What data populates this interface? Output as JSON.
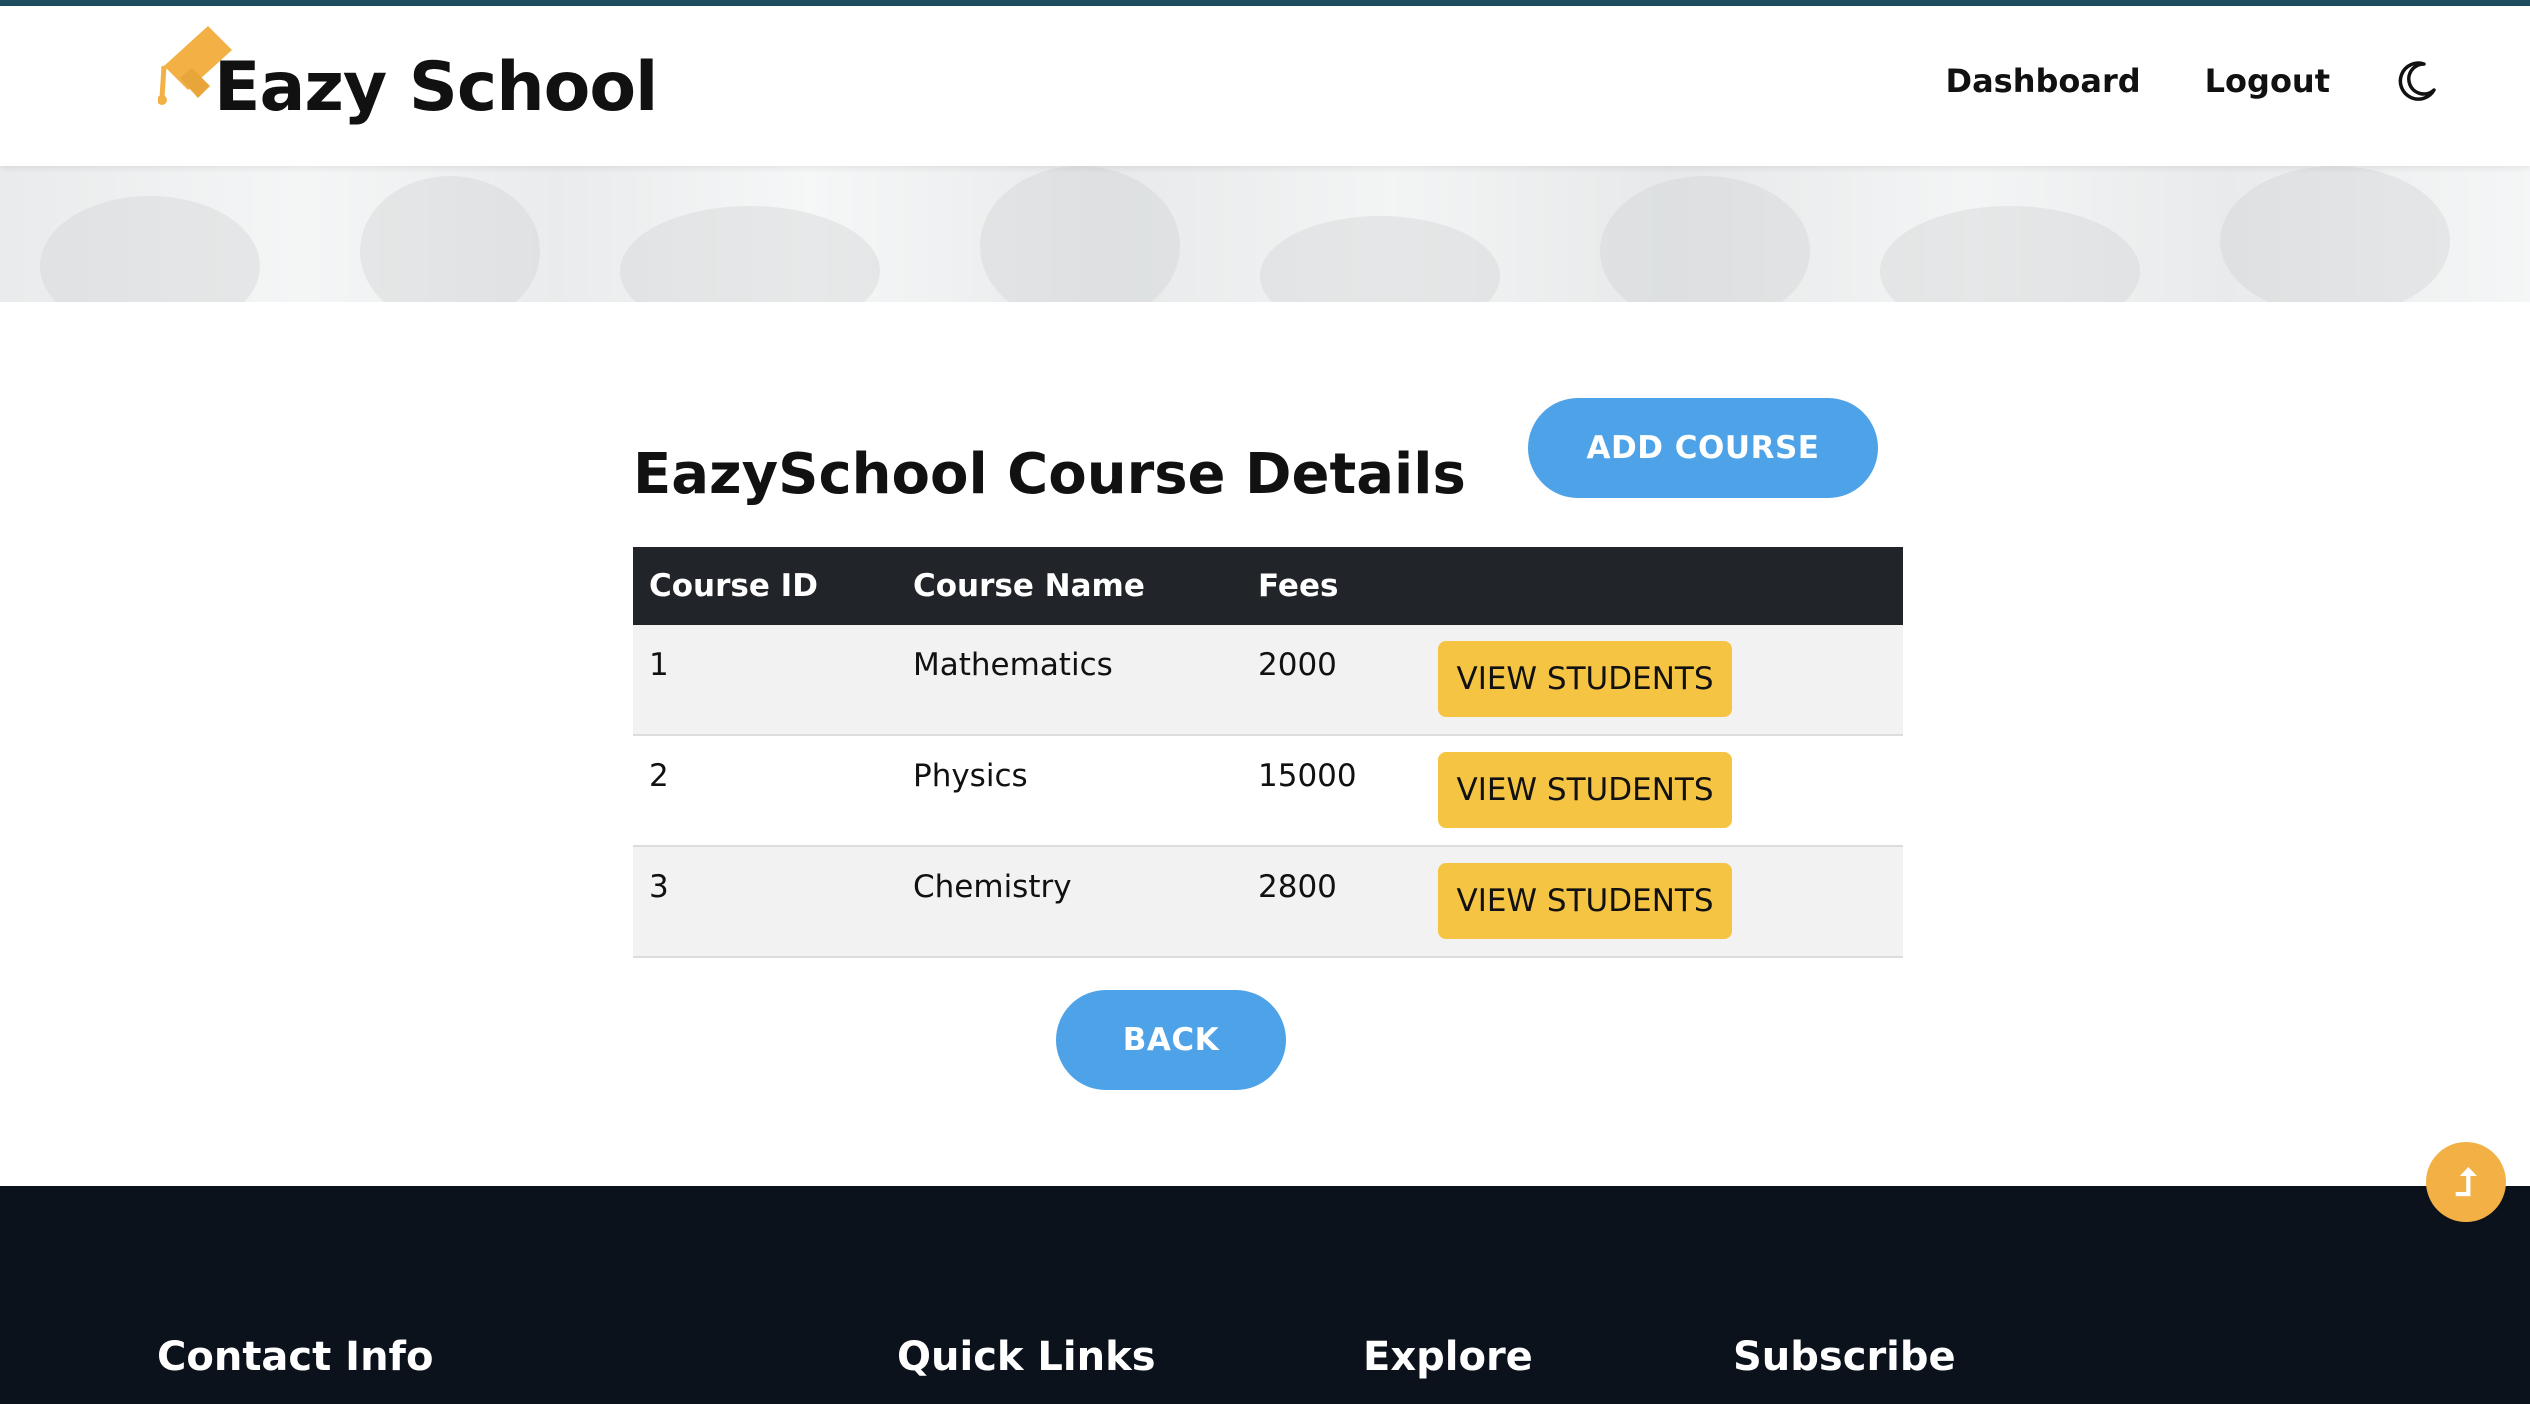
{
  "brand": {
    "name": "Eazy School",
    "icon": "graduation-cap-icon",
    "accent": "#f2b045"
  },
  "nav": {
    "dashboard": "Dashboard",
    "logout": "Logout",
    "theme_icon": "moon-icon"
  },
  "main": {
    "title": "EazySchool Course Details",
    "add_button": "ADD COURSE",
    "back_button": "BACK",
    "table": {
      "headers": [
        "Course ID",
        "Course Name",
        "Fees",
        ""
      ],
      "rows": [
        {
          "id": "1",
          "name": "Mathematics",
          "fees": "2000",
          "action": "VIEW STUDENTS"
        },
        {
          "id": "2",
          "name": "Physics",
          "fees": "15000",
          "action": "VIEW STUDENTS"
        },
        {
          "id": "3",
          "name": "Chemistry",
          "fees": "2800",
          "action": "VIEW STUDENTS"
        }
      ]
    }
  },
  "footer": {
    "headings": [
      "Contact Info",
      "Quick Links",
      "Explore",
      "Subscribe"
    ]
  },
  "scroll_top": {
    "icon": "arrow-up-icon",
    "glyph": "⮥"
  },
  "colors": {
    "primary": "#4ea3e8",
    "warning": "#f5c443",
    "table_header": "#212429",
    "footer_bg": "#0c121c"
  }
}
